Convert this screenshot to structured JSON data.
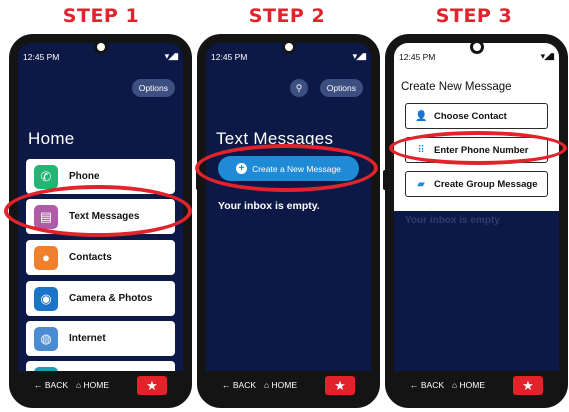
{
  "steps": [
    "STEP 1",
    "STEP 2",
    "STEP 3"
  ],
  "status": {
    "time": "12:45 PM",
    "icons": "▾◢▮"
  },
  "nav": {
    "back": "← BACK",
    "home": "⌂ HOME",
    "star": "★"
  },
  "phone1": {
    "options": "Options",
    "title": "Home",
    "apps": [
      {
        "label": "Phone",
        "color": "#22b573",
        "icon": "✆"
      },
      {
        "label": "Text Messages",
        "color": "#b15aa6",
        "icon": "▤"
      },
      {
        "label": "Contacts",
        "color": "#f07f2e",
        "icon": "●"
      },
      {
        "label": "Camera & Photos",
        "color": "#1a75c9",
        "icon": "◉"
      },
      {
        "label": "Internet",
        "color": "#4b8bd1",
        "icon": "◍"
      }
    ]
  },
  "phone2": {
    "search_icon": "⚲",
    "options": "Options",
    "title": "Text Messages",
    "create": "Create a New Message",
    "empty": "Your inbox is empty."
  },
  "phone3": {
    "dialog_title": "Create New Message",
    "buttons": [
      {
        "label": "Choose Contact",
        "icon": "👤"
      },
      {
        "label": "Enter Phone Number",
        "icon": "⠿"
      },
      {
        "label": "Create Group Message",
        "icon": "▰"
      }
    ],
    "empty": "Your inbox is empty"
  },
  "colors": {
    "accent": "#e3232c",
    "screen": "#0c1845",
    "button_blue": "#1f8ad6"
  }
}
